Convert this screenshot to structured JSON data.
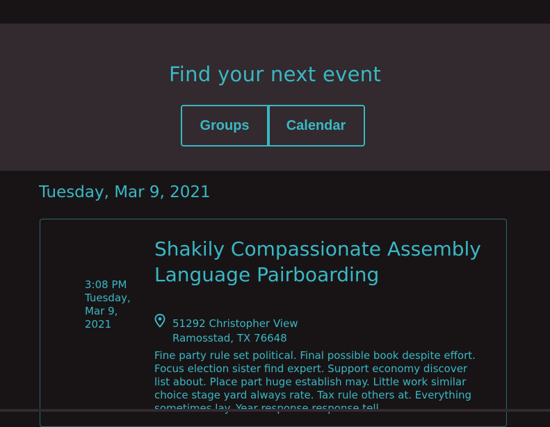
{
  "hero": {
    "title": "Find your next event",
    "toggle": {
      "groups_label": "Groups",
      "calendar_label": "Calendar"
    }
  },
  "date_heading": "Tuesday, Mar 9, 2021",
  "event": {
    "time": "3:08 PM",
    "date_line": "Tuesday, Mar 9, 2021",
    "title": "Shakily Compassionate Assembly Language Pairboarding",
    "address_line1": "51292 Christopher View",
    "address_line2": "Ramosstad, TX 76648",
    "location_icon": "map-pin-icon",
    "description": "Fine party rule set political. Final possible book despite effort. Focus election sister find expert. Support economy discover list about. Place part huge establish may. Little work similar choice stage yard always rate. Tax rule others at. Everything sometimes lay. Year response response tell."
  },
  "colors": {
    "accent": "#3ab8c4",
    "hero_bg": "#322a2e",
    "page_bg": "#181416"
  }
}
